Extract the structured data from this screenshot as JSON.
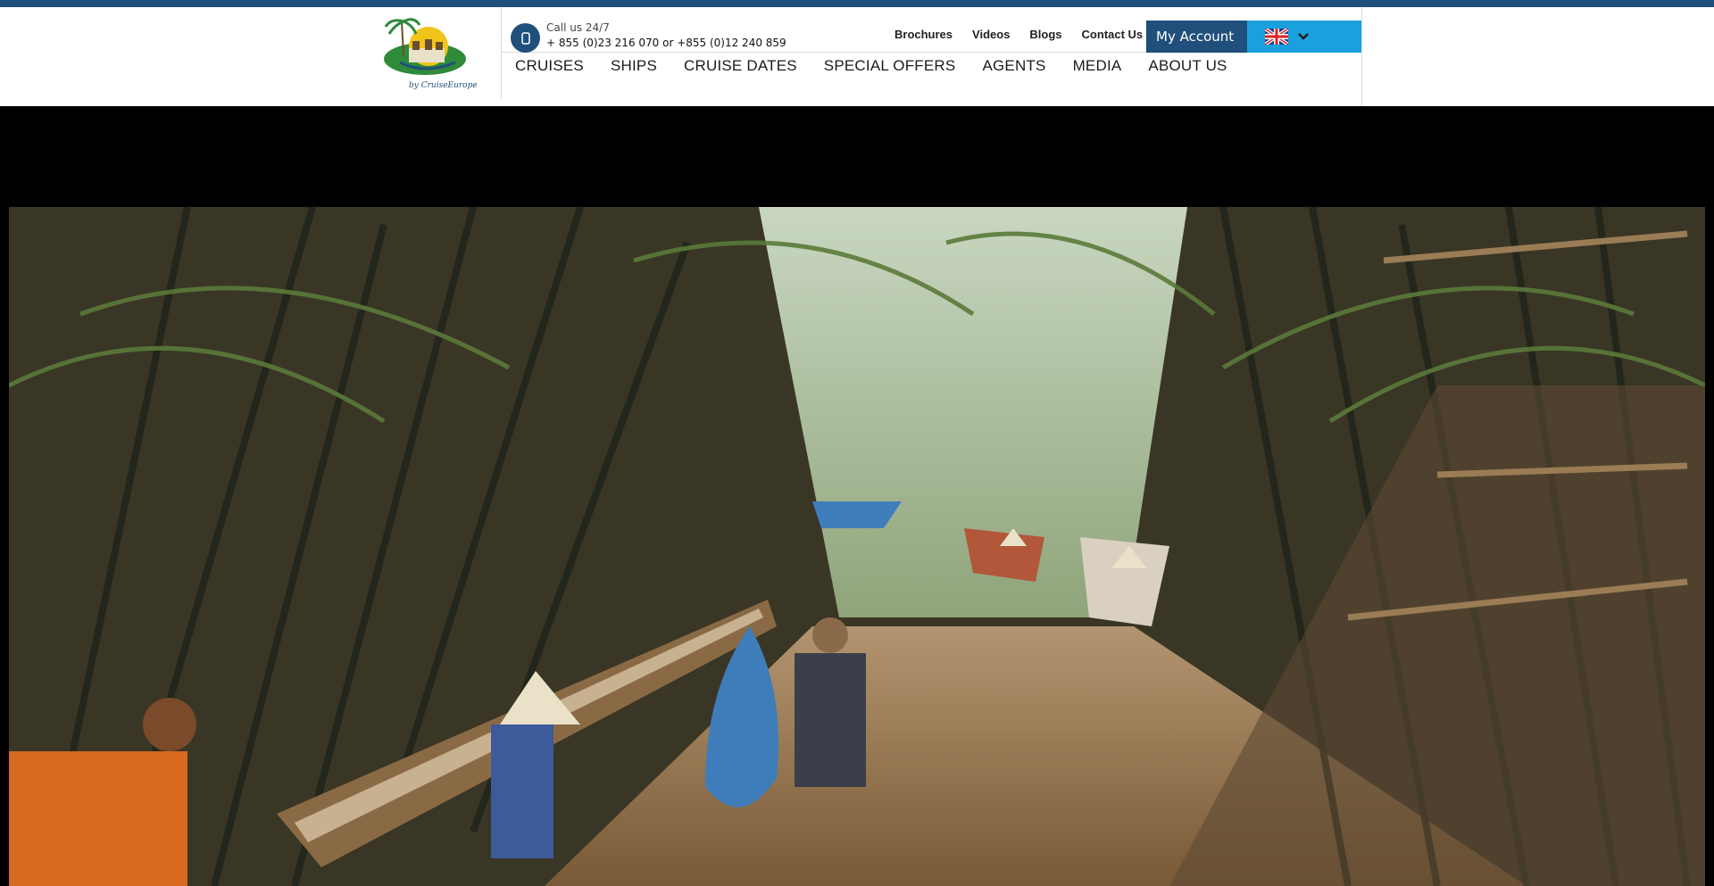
{
  "header": {
    "call_label": "Call us 24/7",
    "call_numbers": "+ 855 (0)23 216 070 or +855 (0)12 240 859",
    "logo_alt": "Cruise Europe",
    "top_links": [
      "Brochures",
      "Videos",
      "Blogs",
      "Contact Us"
    ],
    "account_label": "My Account",
    "language_icon": "uk-flag-icon"
  },
  "nav": {
    "items": [
      "CRUISES",
      "SHIPS",
      "CRUISE DATES",
      "SPECIAL OFFERS",
      "AGENTS",
      "MEDIA",
      "ABOUT US"
    ]
  },
  "hero": {
    "description_icon": "mekong-canal-boats-photo"
  },
  "colors": {
    "brand_navy": "#1f4f7a",
    "language_blue": "#1aa0dc"
  }
}
